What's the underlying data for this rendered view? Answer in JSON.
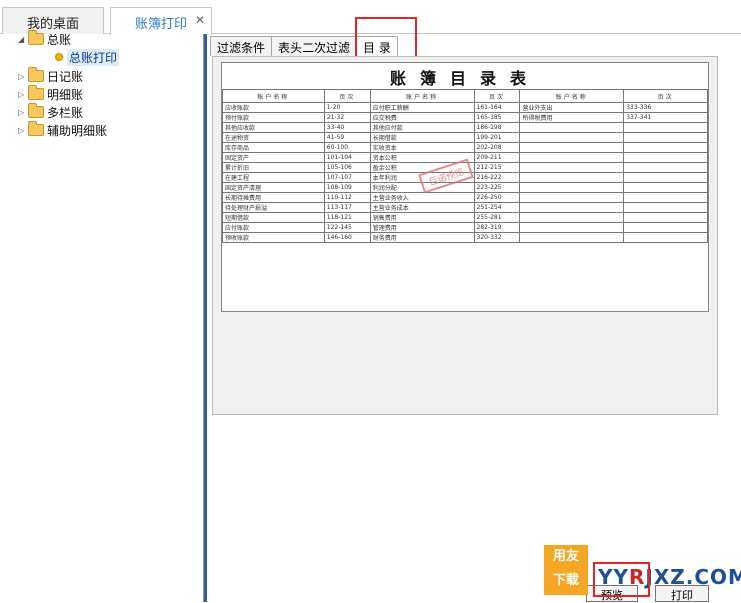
{
  "tabs": {
    "desktop": "我的桌面",
    "ledger_print": "账簿打印",
    "close": "✕"
  },
  "tree": {
    "root": "总账",
    "general_print": "总账打印",
    "journal": "日记账",
    "detail": "明细账",
    "multicolumn": "多栏账",
    "aux_detail": "辅助明细账"
  },
  "subtabs": {
    "filter": "过滤条件",
    "header_filter": "表头二次过滤",
    "catalog": "目 录"
  },
  "report": {
    "title": "账簿目录表",
    "col_name": "账户名称",
    "col_page": "页次",
    "stamp": "巨诺预览",
    "rows": [
      [
        "应收账款",
        "1-20",
        "应付职工薪酬",
        "161-164",
        "营业外支出",
        "333-336"
      ],
      [
        "预付账款",
        "21-32",
        "应交税费",
        "165-185",
        "所得税费用",
        "337-341"
      ],
      [
        "其他应收款",
        "33-40",
        "其他应付款",
        "186-198",
        "",
        ""
      ],
      [
        "在途物资",
        "41-59",
        "长期借款",
        "199-201",
        "",
        ""
      ],
      [
        "库存商品",
        "60-100",
        "实收资本",
        "202-208",
        "",
        ""
      ],
      [
        "固定资产",
        "101-104",
        "资本公积",
        "209-211",
        "",
        ""
      ],
      [
        "累计折旧",
        "105-106",
        "盈余公积",
        "212-215",
        "",
        ""
      ],
      [
        "在建工程",
        "107-107",
        "本年利润",
        "216-222",
        "",
        ""
      ],
      [
        "固定资产清理",
        "108-109",
        "利润分配",
        "223-225",
        "",
        ""
      ],
      [
        "长期待摊费用",
        "110-112",
        "主营业务收入",
        "226-250",
        "",
        ""
      ],
      [
        "待处理财产损溢",
        "113-117",
        "主营业务成本",
        "251-254",
        "",
        ""
      ],
      [
        "短期借款",
        "118-121",
        "销售费用",
        "255-281",
        "",
        ""
      ],
      [
        "应付账款",
        "122-145",
        "管理费用",
        "282-319",
        "",
        ""
      ],
      [
        "预收账款",
        "146-160",
        "财务费用",
        "320-332",
        "",
        ""
      ]
    ]
  },
  "bottom": {
    "preview_btn": "预览",
    "print_btn": "打印"
  },
  "watermark": {
    "logo_line1": "用友",
    "logo_line2": "下载",
    "text_a": "YY",
    "text_b": "R",
    "text_c": "JXZ.COM"
  }
}
